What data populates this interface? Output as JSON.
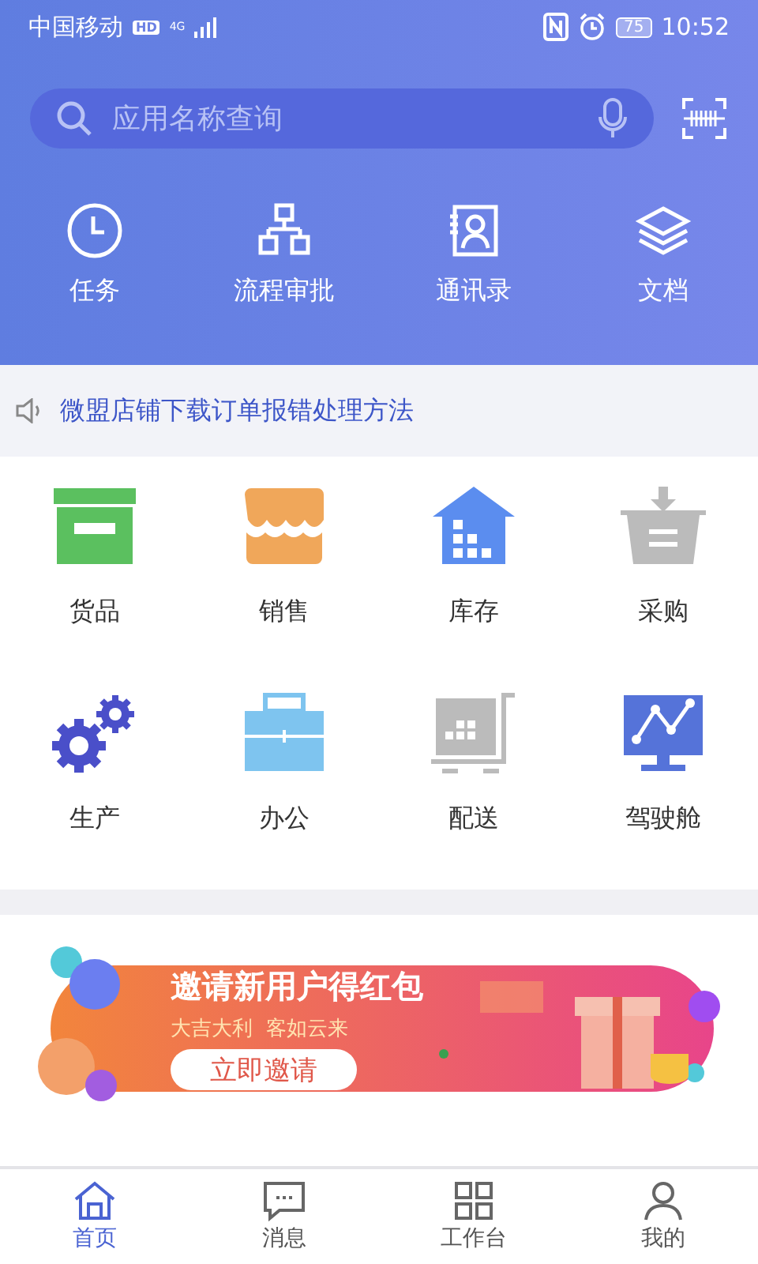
{
  "status_bar": {
    "carrier": "中国移动",
    "hd": "HD",
    "network": "4G",
    "battery": "75",
    "time": "10:52"
  },
  "search": {
    "placeholder": "应用名称查询"
  },
  "quick_actions": [
    {
      "kind": "clock",
      "label": "任务"
    },
    {
      "kind": "flow",
      "label": "流程审批"
    },
    {
      "kind": "contacts",
      "label": "通讯录"
    },
    {
      "kind": "layers",
      "label": "文档"
    }
  ],
  "notice": {
    "text": "微盟店铺下载订单报错处理方法"
  },
  "apps": [
    {
      "kind": "goods",
      "label": "货品"
    },
    {
      "kind": "sales",
      "label": "销售"
    },
    {
      "kind": "stock",
      "label": "库存"
    },
    {
      "kind": "purchase",
      "label": "采购"
    },
    {
      "kind": "production",
      "label": "生产"
    },
    {
      "kind": "office",
      "label": "办公"
    },
    {
      "kind": "delivery",
      "label": "配送"
    },
    {
      "kind": "cockpit",
      "label": "驾驶舱"
    }
  ],
  "banner": {
    "kind": "picture",
    "title": "邀请新用户得红包",
    "subtitle": "大吉大利  客如云来",
    "button": "立即邀请"
  },
  "tab_bar": [
    {
      "kind": "home",
      "label": "首页",
      "selected": true
    },
    {
      "kind": "message",
      "label": "消息",
      "selected": false
    },
    {
      "kind": "work",
      "label": "工作台",
      "selected": false
    },
    {
      "kind": "me",
      "label": "我的",
      "selected": false
    }
  ]
}
